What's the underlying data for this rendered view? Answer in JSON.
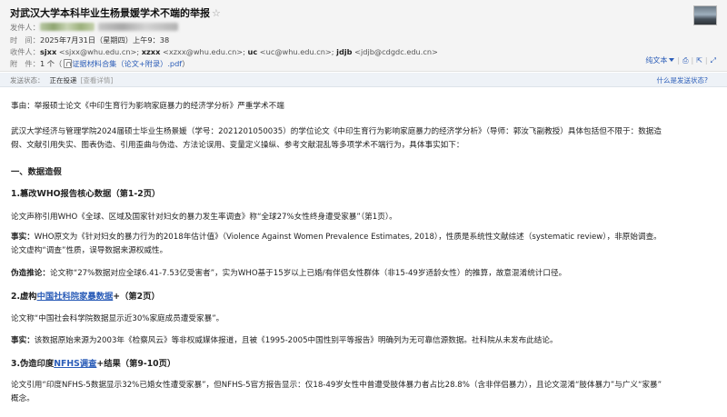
{
  "email": {
    "subject": "对武汉大学本科毕业生杨景媛学术不端的举报",
    "star": "☆",
    "labels": {
      "from": "发件人：",
      "time": "时　间：",
      "to": "收件人：",
      "attachments": "附　件："
    },
    "time": "2025年7月31日（星期四）上午9：38",
    "recipients": [
      {
        "name": "sjxx",
        "email": "<sjxx@whu.edu.cn>;"
      },
      {
        "name": "xzxx",
        "email": "<xzxx@whu.edu.cn>;"
      },
      {
        "name": "uc",
        "email": "<uc@whu.edu.cn>;"
      },
      {
        "name": "jdjb",
        "email": "<jdjb@cdgdc.edu.cn>"
      }
    ],
    "attachment_count": "1 个",
    "attachment_name": "证据材料合集（论文+附录）.pdf",
    "actions": {
      "plain_text": "纯文本",
      "print": "",
      "forward": ""
    },
    "status_label": "发送状态：",
    "status_value": "正在投递",
    "status_details": "[查看详情]",
    "status_help": "什么是发送状态?"
  },
  "body": {
    "reason": "事由：举报硕士论文《中印生育行为影响家庭暴力的经济学分析》严重学术不端",
    "intro_1": "武汉大学经济与管理学院2024届硕士毕业生杨景媛（学号：2021201050035）的学位论文《中印生育行为影响家庭暴力的经济学分析》（导师：郭汝飞副教授）具体包括但不限于：数据造",
    "intro_2": "假、文献引用失实、图表伪造、引用歪曲与伪造、方法论误用、变量定义操纵、参考文献混乱等多项学术不端行为，具体事实如下：",
    "section_1": "一、数据造假",
    "item_1_title": "1.篡改WHO报告核心数据（第1-2页）",
    "item_1_claim": "论文声称引用WHO《全球、区域及国家针对妇女的暴力发生率调查》称“全球27%女性终身遭受家暴”（第1页）。",
    "fact_label": "事实：",
    "item_1_fact_1": "WHO原文为《针对妇女的暴力行为的2018年估计值》（Violence Against Women Prevalence Estimates, 2018），性质是系统性文献综述（systematic review），非原始调查。",
    "item_1_fact_2": "论文虚构“调查”性质，误导数据来源权威性。",
    "falsified_label": "伪造推论：",
    "item_1_falsified": "论文称“27%数据对应全球6.41-7.53亿受害者”，实为WHO基于15岁以上已婚/有伴侣女性群体（非15-49岁适龄女性）的推算，故意混淆统计口径。",
    "item_2_prefix": "2.虚构",
    "item_2_link": "中国社科院家暴数据",
    "item_2_suffix": "+（第2页）",
    "item_2_claim": "论文称“中国社会科学院数据显示近30%家庭成员遭受家暴”。",
    "item_2_fact": "该数据原始来源为2003年《检察风云》等非权威媒体报道，且被《1995-2005中国性别平等报告》明确列为无可靠信源数据。社科院从未发布此结论。",
    "item_3_prefix": "3.伪造印度",
    "item_3_link": "NFHS调查",
    "item_3_suffix": "+结果（第9-10页）",
    "item_3_claim_1": "论文引用“印度NFHS-5数据显示32%已婚女性遭受家暴”，但NFHS-5官方报告显示：仅18-49岁女性中曾遭受肢体暴力者占比28.8%（含非伴侣暴力），且论文混淆“肢体暴力”与广义“家暴”",
    "item_3_claim_2": "概念。"
  }
}
